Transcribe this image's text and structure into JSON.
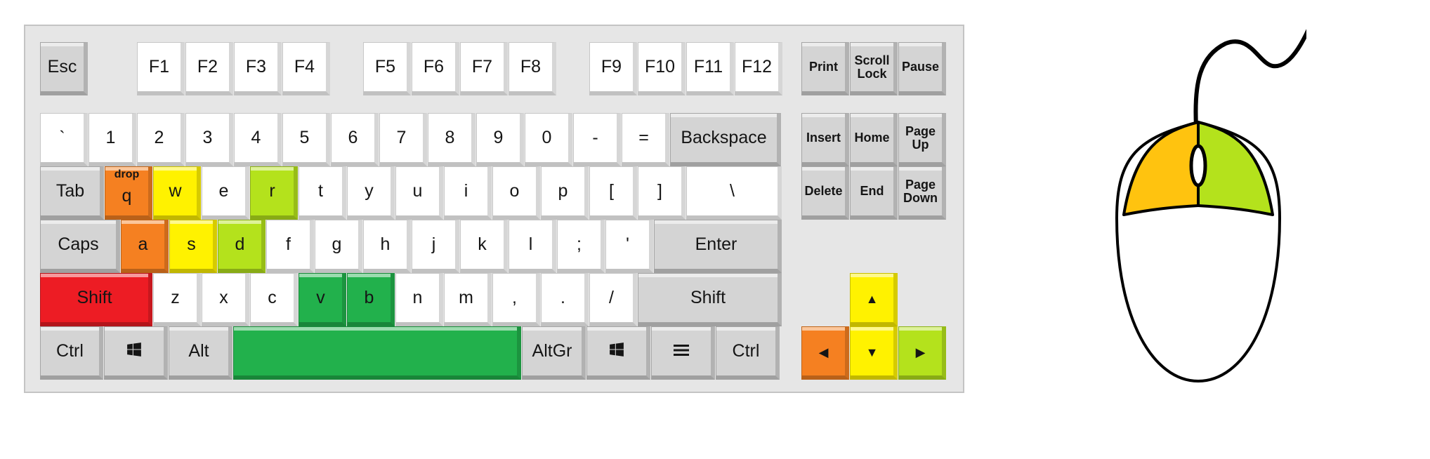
{
  "colors": {
    "white": "#ffffff",
    "gray": "#d4d4d4",
    "orange": "#f58021",
    "yellow": "#fff200",
    "lime": "#b4e21c",
    "green": "#22b14c",
    "red": "#ed1c24",
    "mouse_left": "#ffc30f",
    "mouse_right": "#b4e21c"
  },
  "rows": {
    "function": [
      "Esc",
      "F1",
      "F2",
      "F3",
      "F4",
      "F5",
      "F6",
      "F7",
      "F8",
      "F9",
      "F10",
      "F11",
      "F12"
    ],
    "number": [
      "`",
      "1",
      "2",
      "3",
      "4",
      "5",
      "6",
      "7",
      "8",
      "9",
      "0",
      "-",
      "=",
      "Backspace"
    ],
    "top": [
      "Tab",
      "q",
      "w",
      "e",
      "r",
      "t",
      "y",
      "u",
      "i",
      "o",
      "p",
      "[",
      "]",
      "\\"
    ],
    "home": [
      "Caps",
      "a",
      "s",
      "d",
      "f",
      "g",
      "h",
      "j",
      "k",
      "l",
      ";",
      "'",
      "Enter"
    ],
    "shift": [
      "Shift",
      "z",
      "x",
      "c",
      "v",
      "b",
      "n",
      "m",
      ",",
      ".",
      "/",
      "Shift"
    ],
    "bottom": [
      "Ctrl",
      "win-icon",
      "Alt",
      "",
      "AltGr",
      "win-icon",
      "menu-icon",
      "Ctrl"
    ]
  },
  "nav_cluster": {
    "row1": [
      "Print",
      "Scroll\nLock",
      "Pause"
    ],
    "row2": [
      "Insert",
      "Home",
      "Page\nUp"
    ],
    "row3": [
      "Delete",
      "End",
      "Page\nDown"
    ]
  },
  "arrows": [
    "arrow-up-icon",
    "arrow-left-icon",
    "arrow-down-icon",
    "arrow-right-icon"
  ],
  "annotations": {
    "q": "drop"
  },
  "highlights": {
    "q": "orange",
    "a": "orange",
    "w": "yellow",
    "s": "yellow",
    "r": "lime",
    "d": "lime",
    "v": "green",
    "b": "green",
    "space": "green",
    "left_shift": "red",
    "arrow_left": "orange",
    "arrow_up": "yellow",
    "arrow_down": "yellow",
    "arrow_right": "lime"
  },
  "mouse": {
    "left_button_color": "mouse_left",
    "right_button_color": "mouse_right"
  }
}
